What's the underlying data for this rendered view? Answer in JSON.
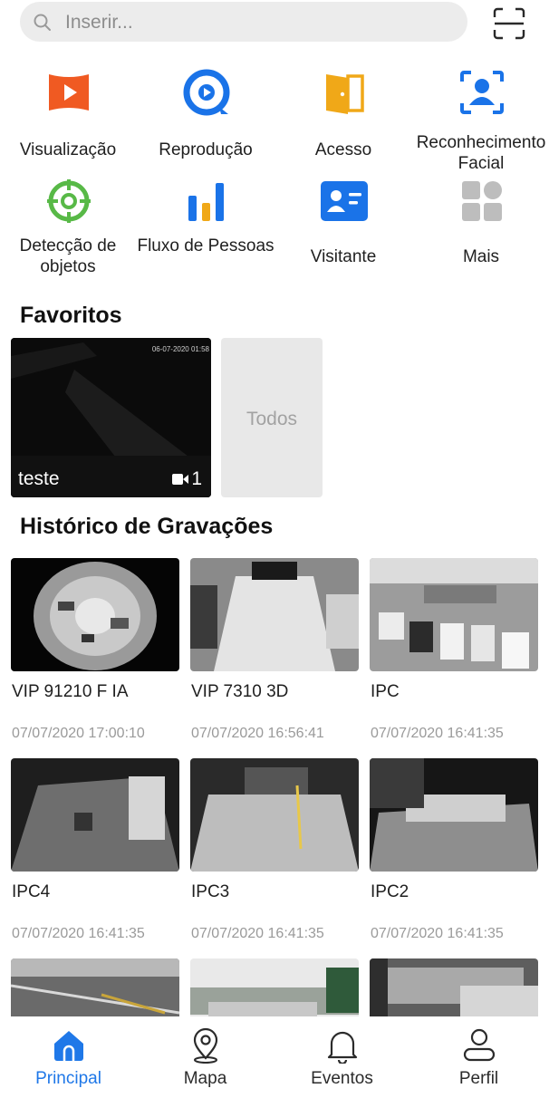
{
  "search": {
    "placeholder": "Inserir..."
  },
  "shortcuts": [
    {
      "label": "Visualização",
      "icon": "live-view-icon",
      "color": "#f05a22"
    },
    {
      "label": "Reprodução",
      "icon": "playback-icon",
      "color": "#1a73e8"
    },
    {
      "label": "Acesso",
      "icon": "door-access-icon",
      "color": "#f0a818"
    },
    {
      "label": "Reconhecimento Facial",
      "icon": "face-recognition-icon",
      "color": "#1a73e8"
    },
    {
      "label": "Detecção de objetos",
      "icon": "object-detection-icon",
      "color": "#58b947"
    },
    {
      "label": "Fluxo de Pessoas",
      "icon": "people-flow-icon",
      "color": "#1a73e8"
    },
    {
      "label": "Visitante",
      "icon": "visitor-card-icon",
      "color": "#1a73e8"
    },
    {
      "label": "Mais",
      "icon": "more-grid-icon",
      "color": "#bdbdbd"
    }
  ],
  "favorites": {
    "title": "Favoritos",
    "card": {
      "name": "teste",
      "count": "1",
      "stamp": "06-07-2020 01:58"
    },
    "all_label": "Todos"
  },
  "history": {
    "title": "Histórico de Gravações",
    "items": [
      {
        "title": "VIP 91210 F IA",
        "date": "07/07/2020 17:00:10"
      },
      {
        "title": "VIP 7310 3D",
        "date": "07/07/2020 16:56:41"
      },
      {
        "title": "IPC",
        "date": "07/07/2020 16:41:35"
      },
      {
        "title": "IPC4",
        "date": "07/07/2020 16:41:35"
      },
      {
        "title": "IPC3",
        "date": "07/07/2020 16:41:35"
      },
      {
        "title": "IPC2",
        "date": "07/07/2020 16:41:35"
      },
      {
        "title": "",
        "date": ""
      },
      {
        "title": "",
        "date": ""
      },
      {
        "title": "",
        "date": ""
      }
    ]
  },
  "tabs": [
    {
      "label": "Principal",
      "icon": "home-icon",
      "active": true
    },
    {
      "label": "Mapa",
      "icon": "map-pin-icon",
      "active": false
    },
    {
      "label": "Eventos",
      "icon": "bell-icon",
      "active": false
    },
    {
      "label": "Perfil",
      "icon": "person-icon",
      "active": false
    }
  ],
  "colors": {
    "accent": "#1f78e8",
    "tile_bg": "#e8e8e8"
  }
}
